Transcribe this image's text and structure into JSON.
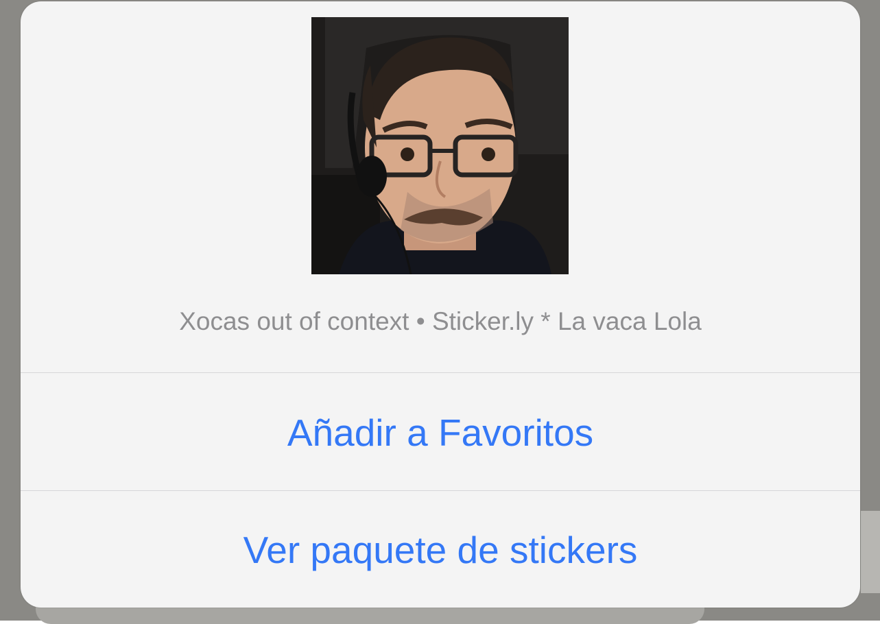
{
  "sticker": {
    "caption": "Xocas out of context • Sticker.ly * La vaca Lola",
    "image_description_icon": "sticker-portrait"
  },
  "actions": [
    {
      "label": "Añadir a Favoritos"
    },
    {
      "label": "Ver paquete de stickers"
    }
  ],
  "colors": {
    "accent": "#3478f6",
    "caption": "#8e8e90",
    "sheet": "#f4f4f4",
    "backdrop": "#8a8985"
  }
}
